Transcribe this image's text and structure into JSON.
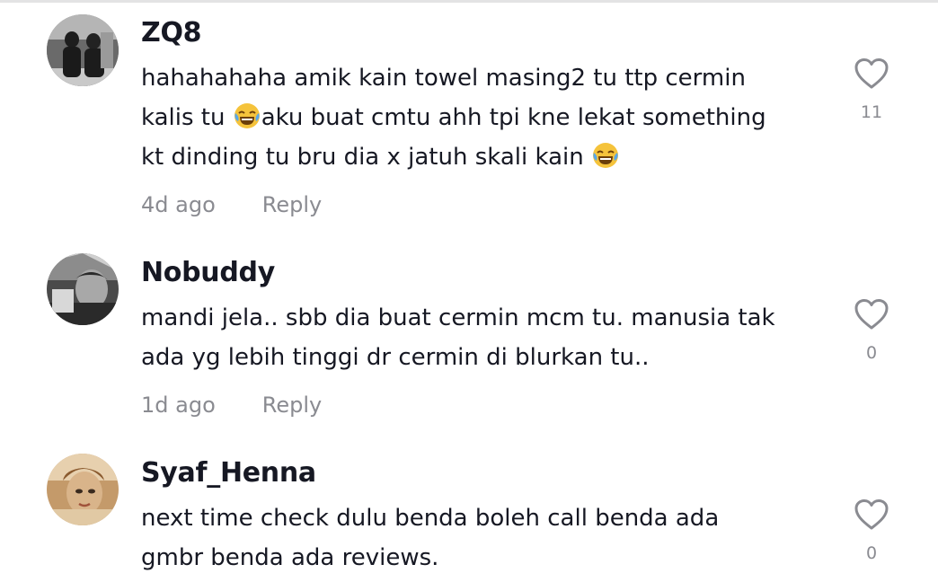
{
  "comments": [
    {
      "username": "ZQ8",
      "lines": [
        "hahahahaha amik kain towel masing2 tu ttp cermin",
        "kalis tu ",
        "aku buat cmtu ahh tpi kne lekat something",
        "kt dinding tu bru dia x jatuh skali kain "
      ],
      "time": "4d ago",
      "reply": "Reply",
      "likes": "11"
    },
    {
      "username": "Nobuddy",
      "lines": [
        "mandi jela.. sbb dia buat cermin mcm tu. manusia tak",
        "ada yg lebih tinggi dr cermin di blurkan tu.."
      ],
      "time": "1d ago",
      "reply": "Reply",
      "likes": "0"
    },
    {
      "username": "Syaf_Henna",
      "lines": [
        "next time check dulu benda boleh call benda ada",
        "gmbr benda ada reviews."
      ],
      "likes": "0"
    }
  ],
  "icons": {
    "like": "heart-outline-icon",
    "emoji": "face-with-tears-of-joy-emoji"
  }
}
